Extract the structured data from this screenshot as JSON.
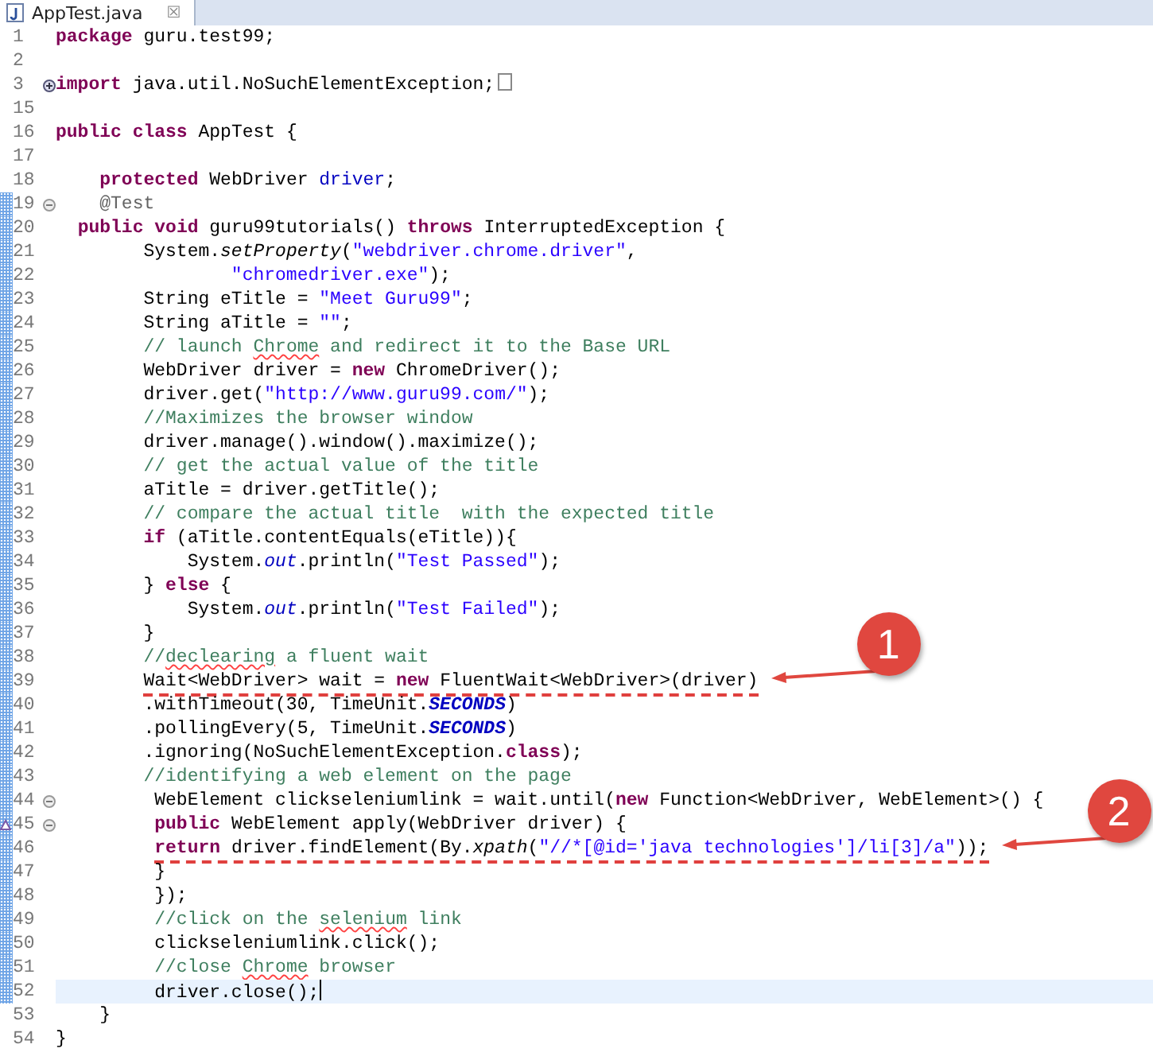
{
  "tab": {
    "title": "AppTest.java",
    "close": "☒"
  },
  "lines": [
    {
      "number": "1",
      "collapsed": false,
      "expanded": false,
      "changed": false,
      "current": false,
      "underlined": false,
      "override": false,
      "tokens": [
        {
          "kind": "kw",
          "text": "package"
        },
        {
          "kind": "plain",
          "text": " guru.test99;"
        }
      ]
    },
    {
      "number": "2",
      "collapsed": false,
      "expanded": false,
      "changed": false,
      "current": false,
      "underlined": false,
      "override": false
    },
    {
      "number": "3",
      "collapsed": true,
      "expanded": false,
      "changed": false,
      "current": false,
      "underlined": false,
      "override": false,
      "tokens": [
        {
          "kind": "kw",
          "text": "import"
        },
        {
          "kind": "plain",
          "text": " java.util.NoSuchElementException;"
        }
      ]
    },
    {
      "number": "15",
      "collapsed": false,
      "expanded": false,
      "changed": false,
      "current": false,
      "underlined": false,
      "override": false
    },
    {
      "number": "16",
      "collapsed": false,
      "expanded": false,
      "changed": false,
      "current": false,
      "underlined": false,
      "override": false,
      "tokens": [
        {
          "kind": "kw",
          "text": "public"
        },
        {
          "kind": "kw",
          "text": " class"
        },
        {
          "kind": "plain",
          "text": " AppTest {"
        }
      ]
    },
    {
      "number": "17",
      "collapsed": false,
      "expanded": false,
      "changed": false,
      "current": false,
      "underlined": false,
      "override": false
    },
    {
      "number": "18",
      "collapsed": false,
      "expanded": false,
      "changed": false,
      "current": false,
      "underlined": false,
      "override": false,
      "tokens": [
        {
          "kind": "kw",
          "text": "    protected"
        },
        {
          "kind": "plain",
          "text": " WebDriver "
        },
        {
          "kind": "field",
          "text": "driver"
        },
        {
          "kind": "plain",
          "text": ";"
        }
      ]
    },
    {
      "number": "19",
      "collapsed": false,
      "expanded": true,
      "changed": true,
      "current": false,
      "underlined": false,
      "override": false,
      "tokens": [
        {
          "kind": "annotation",
          "text": "    @Test"
        }
      ]
    },
    {
      "number": "20",
      "collapsed": false,
      "expanded": false,
      "changed": true,
      "current": false,
      "underlined": false,
      "override": false,
      "tokens": [
        {
          "kind": "kw",
          "text": "  public"
        },
        {
          "kind": "kw",
          "text": " void"
        },
        {
          "kind": "plain",
          "text": " guru99tutorials() "
        },
        {
          "kind": "kw",
          "text": "throws"
        },
        {
          "kind": "plain",
          "text": " InterruptedException {"
        }
      ]
    },
    {
      "number": "21",
      "collapsed": false,
      "expanded": false,
      "changed": true,
      "current": false,
      "underlined": false,
      "override": false,
      "tokens": [
        {
          "kind": "plain",
          "text": "        System."
        },
        {
          "kind": "static-method",
          "text": "setProperty"
        },
        {
          "kind": "plain",
          "text": "("
        },
        {
          "kind": "str",
          "text": "\"webdriver.chrome.driver\""
        },
        {
          "kind": "plain",
          "text": ","
        }
      ]
    },
    {
      "number": "22",
      "collapsed": false,
      "expanded": false,
      "changed": true,
      "current": false,
      "underlined": false,
      "override": false,
      "tokens": [
        {
          "kind": "str",
          "text": "                \"chromedriver.exe\""
        },
        {
          "kind": "plain",
          "text": ");"
        }
      ]
    },
    {
      "number": "23",
      "collapsed": false,
      "expanded": false,
      "changed": true,
      "current": false,
      "underlined": false,
      "override": false,
      "tokens": [
        {
          "kind": "plain",
          "text": "        String eTitle = "
        },
        {
          "kind": "str",
          "text": "\"Meet Guru99\""
        },
        {
          "kind": "plain",
          "text": ";"
        }
      ]
    },
    {
      "number": "24",
      "collapsed": false,
      "expanded": false,
      "changed": true,
      "current": false,
      "underlined": false,
      "override": false,
      "tokens": [
        {
          "kind": "plain",
          "text": "        String aTitle = "
        },
        {
          "kind": "str",
          "text": "\"\""
        },
        {
          "kind": "plain",
          "text": ";"
        }
      ]
    },
    {
      "number": "25",
      "collapsed": false,
      "expanded": false,
      "changed": true,
      "current": false,
      "underlined": false,
      "override": false,
      "tokens": [
        {
          "kind": "comment",
          "text": "        // launch "
        },
        {
          "kind": "misspelled",
          "text": "Chrome"
        },
        {
          "kind": "comment",
          "text": " and redirect it to the Base URL"
        }
      ]
    },
    {
      "number": "26",
      "collapsed": false,
      "expanded": false,
      "changed": true,
      "current": false,
      "underlined": false,
      "override": false,
      "tokens": [
        {
          "kind": "plain",
          "text": "        WebDriver driver = "
        },
        {
          "kind": "kw",
          "text": "new"
        },
        {
          "kind": "plain",
          "text": " ChromeDriver();"
        }
      ]
    },
    {
      "number": "27",
      "collapsed": false,
      "expanded": false,
      "changed": true,
      "current": false,
      "underlined": false,
      "override": false,
      "tokens": [
        {
          "kind": "plain",
          "text": "        driver.get("
        },
        {
          "kind": "str",
          "text": "\"http://www.guru99.com/\""
        },
        {
          "kind": "plain",
          "text": ");"
        }
      ]
    },
    {
      "number": "28",
      "collapsed": false,
      "expanded": false,
      "changed": true,
      "current": false,
      "underlined": false,
      "override": false,
      "tokens": [
        {
          "kind": "comment",
          "text": "        //Maximizes the browser window"
        }
      ]
    },
    {
      "number": "29",
      "collapsed": false,
      "expanded": false,
      "changed": true,
      "current": false,
      "underlined": false,
      "override": false,
      "tokens": [
        {
          "kind": "plain",
          "text": "        driver.manage().window().maximize();"
        }
      ]
    },
    {
      "number": "30",
      "collapsed": false,
      "expanded": false,
      "changed": true,
      "current": false,
      "underlined": false,
      "override": false,
      "tokens": [
        {
          "kind": "comment",
          "text": "        // get the actual value of the title"
        }
      ]
    },
    {
      "number": "31",
      "collapsed": false,
      "expanded": false,
      "changed": true,
      "current": false,
      "underlined": false,
      "override": false,
      "tokens": [
        {
          "kind": "plain",
          "text": "        aTitle = driver.getTitle();"
        }
      ]
    },
    {
      "number": "32",
      "collapsed": false,
      "expanded": false,
      "changed": true,
      "current": false,
      "underlined": false,
      "override": false,
      "tokens": [
        {
          "kind": "comment",
          "text": "        // compare the actual title  with the expected title"
        }
      ]
    },
    {
      "number": "33",
      "collapsed": false,
      "expanded": false,
      "changed": true,
      "current": false,
      "underlined": false,
      "override": false,
      "tokens": [
        {
          "kind": "kw",
          "text": "        if"
        },
        {
          "kind": "plain",
          "text": " (aTitle.contentEquals(eTitle)){"
        }
      ]
    },
    {
      "number": "34",
      "collapsed": false,
      "expanded": false,
      "changed": true,
      "current": false,
      "underlined": false,
      "override": false,
      "tokens": [
        {
          "kind": "plain",
          "text": "            System."
        },
        {
          "kind": "static-field",
          "text": "out"
        },
        {
          "kind": "plain",
          "text": ".println("
        },
        {
          "kind": "str",
          "text": "\"Test Passed\""
        },
        {
          "kind": "plain",
          "text": ");"
        }
      ]
    },
    {
      "number": "35",
      "collapsed": false,
      "expanded": false,
      "changed": true,
      "current": false,
      "underlined": false,
      "override": false,
      "tokens": [
        {
          "kind": "plain",
          "text": "        } "
        },
        {
          "kind": "kw",
          "text": "else"
        },
        {
          "kind": "plain",
          "text": " {"
        }
      ]
    },
    {
      "number": "36",
      "collapsed": false,
      "expanded": false,
      "changed": true,
      "current": false,
      "underlined": false,
      "override": false,
      "tokens": [
        {
          "kind": "plain",
          "text": "            System."
        },
        {
          "kind": "static-field",
          "text": "out"
        },
        {
          "kind": "plain",
          "text": ".println("
        },
        {
          "kind": "str",
          "text": "\"Test Failed\""
        },
        {
          "kind": "plain",
          "text": ");"
        }
      ]
    },
    {
      "number": "37",
      "collapsed": false,
      "expanded": false,
      "changed": true,
      "current": false,
      "underlined": false,
      "override": false,
      "tokens": [
        {
          "kind": "plain",
          "text": "        }"
        }
      ]
    },
    {
      "number": "38",
      "collapsed": false,
      "expanded": false,
      "changed": true,
      "current": false,
      "underlined": false,
      "override": false,
      "tokens": [
        {
          "kind": "comment",
          "text": "        //"
        },
        {
          "kind": "misspelled",
          "text": "declearing"
        },
        {
          "kind": "comment",
          "text": " a fluent wait"
        }
      ]
    },
    {
      "number": "39",
      "collapsed": false,
      "expanded": false,
      "changed": true,
      "current": false,
      "underlined": true,
      "override": false,
      "callout": "1",
      "tokens": [
        {
          "kind": "plain",
          "text": "        Wait<WebDriver> wait = "
        },
        {
          "kind": "kw",
          "text": "new"
        },
        {
          "kind": "plain",
          "text": " FluentWait<WebDriver>(driver)"
        }
      ]
    },
    {
      "number": "40",
      "collapsed": false,
      "expanded": false,
      "changed": true,
      "current": false,
      "underlined": false,
      "override": false,
      "tokens": [
        {
          "kind": "plain",
          "text": "        .withTimeout(30, TimeUnit."
        },
        {
          "kind": "constant",
          "text": "SECONDS"
        },
        {
          "kind": "plain",
          "text": ")"
        }
      ]
    },
    {
      "number": "41",
      "collapsed": false,
      "expanded": false,
      "changed": true,
      "current": false,
      "underlined": false,
      "override": false,
      "tokens": [
        {
          "kind": "plain",
          "text": "        .pollingEvery(5, TimeUnit."
        },
        {
          "kind": "constant",
          "text": "SECONDS"
        },
        {
          "kind": "plain",
          "text": ")"
        }
      ]
    },
    {
      "number": "42",
      "collapsed": false,
      "expanded": false,
      "changed": true,
      "current": false,
      "underlined": false,
      "override": false,
      "tokens": [
        {
          "kind": "plain",
          "text": "        .ignoring(NoSuchElementException."
        },
        {
          "kind": "kw",
          "text": "class"
        },
        {
          "kind": "plain",
          "text": ");"
        }
      ]
    },
    {
      "number": "43",
      "collapsed": false,
      "expanded": false,
      "changed": true,
      "current": false,
      "underlined": false,
      "override": false,
      "tokens": [
        {
          "kind": "comment",
          "text": "        //identifying a web element on the page"
        }
      ]
    },
    {
      "number": "44",
      "collapsed": false,
      "expanded": true,
      "changed": true,
      "current": false,
      "underlined": false,
      "override": false,
      "tokens": [
        {
          "kind": "plain",
          "text": "         WebElement clickseleniumlink = wait.until("
        },
        {
          "kind": "kw",
          "text": "new"
        },
        {
          "kind": "plain",
          "text": " Function<WebDriver, WebElement>() {"
        }
      ]
    },
    {
      "number": "45",
      "collapsed": false,
      "expanded": true,
      "changed": true,
      "current": false,
      "underlined": false,
      "override": true,
      "tokens": [
        {
          "kind": "kw",
          "text": "         public"
        },
        {
          "kind": "plain",
          "text": " WebElement apply(WebDriver driver) {"
        }
      ]
    },
    {
      "number": "46",
      "collapsed": false,
      "expanded": false,
      "changed": true,
      "current": false,
      "underlined": true,
      "override": false,
      "callout": "2",
      "tokens": [
        {
          "kind": "kw",
          "text": "         return"
        },
        {
          "kind": "plain",
          "text": " driver.findElement(By."
        },
        {
          "kind": "static-method",
          "text": "xpath"
        },
        {
          "kind": "plain",
          "text": "("
        },
        {
          "kind": "str",
          "text": "\"//*[@id='java technologies']/li[3]/a\""
        },
        {
          "kind": "plain",
          "text": "));"
        }
      ]
    },
    {
      "number": "47",
      "collapsed": false,
      "expanded": false,
      "changed": true,
      "current": false,
      "underlined": false,
      "override": false,
      "tokens": [
        {
          "kind": "plain",
          "text": "         }"
        }
      ]
    },
    {
      "number": "48",
      "collapsed": false,
      "expanded": false,
      "changed": true,
      "current": false,
      "underlined": false,
      "override": false,
      "tokens": [
        {
          "kind": "plain",
          "text": "         });"
        }
      ]
    },
    {
      "number": "49",
      "collapsed": false,
      "expanded": false,
      "changed": true,
      "current": false,
      "underlined": false,
      "override": false,
      "tokens": [
        {
          "kind": "comment",
          "text": "         //click on the "
        },
        {
          "kind": "misspelled",
          "text": "selenium"
        },
        {
          "kind": "comment",
          "text": " link"
        }
      ]
    },
    {
      "number": "50",
      "collapsed": false,
      "expanded": false,
      "changed": true,
      "current": false,
      "underlined": false,
      "override": false,
      "tokens": [
        {
          "kind": "plain",
          "text": "         clickseleniumlink.click();"
        }
      ]
    },
    {
      "number": "51",
      "collapsed": false,
      "expanded": false,
      "changed": true,
      "current": false,
      "underlined": false,
      "override": false,
      "tokens": [
        {
          "kind": "comment",
          "text": "         //close "
        },
        {
          "kind": "misspelled",
          "text": "Chrome"
        },
        {
          "kind": "comment",
          "text": " browser"
        }
      ]
    },
    {
      "number": "52",
      "collapsed": false,
      "expanded": false,
      "changed": true,
      "current": true,
      "underlined": false,
      "override": false,
      "tokens": [
        {
          "kind": "plain",
          "text": "         driver.close();"
        }
      ]
    },
    {
      "number": "53",
      "collapsed": false,
      "expanded": false,
      "changed": false,
      "current": false,
      "underlined": false,
      "override": false,
      "tokens": [
        {
          "kind": "plain",
          "text": "    }"
        }
      ]
    },
    {
      "number": "54",
      "collapsed": false,
      "expanded": false,
      "changed": false,
      "current": false,
      "underlined": false,
      "override": false,
      "tokens": [
        {
          "kind": "plain",
          "text": "}"
        }
      ]
    }
  ]
}
